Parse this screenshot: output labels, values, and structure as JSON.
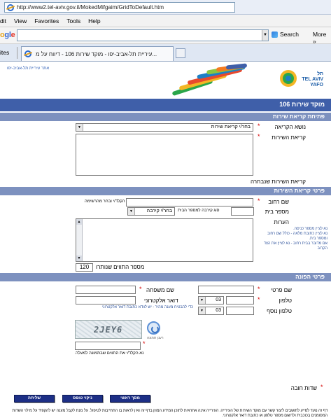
{
  "browser": {
    "address_url": "http://www2.tel-aviv.gov.il/MokedMifgaim/GridToDefault.htm",
    "menu": [
      "dit",
      "View",
      "Favorites",
      "Tools",
      "Help"
    ],
    "search_label": "Search",
    "more_label": "More »",
    "google_logo": "ogle",
    "favorites_label": "ites",
    "tab_title": "עיריית תל-אביב-יפו - מוקד שירות 106 - דיווח על מ..."
  },
  "banner": {
    "site_link": "אתר עיריית תל-אביב-יפו",
    "logo_text_line1": "תל",
    "logo_text_line2": "אביב-",
    "logo_text_line3": "TEL AVIV",
    "logo_text_line4": "YAFO",
    "logo_text_line5": "יפו",
    "stripe_colors": [
      "#2aa64a",
      "#f3b624",
      "#e8492d",
      "#1d7fc6",
      "#8bc53f",
      "#f47b20",
      "#3f5fa9"
    ]
  },
  "page_title": "מוקד שירות 106",
  "sections": {
    "open_call": "פתיחת קריאת שירות",
    "call_details": "פרטי קריאת השירות",
    "contact_details": "פרטי הפונה"
  },
  "open_call": {
    "subject_label": "נושא הקריאה",
    "subject_value": "בחר/י קריאת שירות",
    "service_call_label": "קריאת השירות",
    "selected_call_label": "קריאת השירות שנבחרה"
  },
  "call_details": {
    "street_label": "שם רחוב",
    "street_hint": "הקלד/י ובחר מהרשימה",
    "house_label": "מספר בית",
    "proximity_label": "סוג קירבה למספר הבית",
    "proximity_value": "בחר/י קירבה",
    "notes_label": "הערות",
    "notes_hint_1": "נא לציין מספר כניסה.",
    "notes_hint_2": "נא לציין כתובת מלאה - כולל שם רחוב ומספר בית.",
    "notes_hint_3": "אם מדובר בבית רחוב - נא לציין את הצד הקרוב",
    "chars_left_label": "מספר התווים שנותרו",
    "chars_left_value": "120"
  },
  "contact": {
    "first_name_label": "שם פרטי",
    "last_name_label": "שם משפחה",
    "phone_label": "טלפון",
    "phone_prefix": "03",
    "email_label": "דואר אלקטרוני",
    "email_note": "כדי להבטיח מענה מהיר - יש לוודא כתובת דואר אלקטרוני",
    "phone2_label": "טלפון נוסף",
    "phone2_prefix": "03",
    "captcha_text": "2JEY6",
    "refresh_label": "רענן תמונה",
    "captcha_hint": "נא הקלד/י את התווים שבתמונה למעלה"
  },
  "buttons": {
    "home": "מסך ראשי",
    "clear": "ניקוי טופס",
    "send": "שליחה"
  },
  "required_note": "שדות חובה",
  "footer": "דף זה נועד לסייע לתושבים ליצור קשר עם מוקד השירות של העירייה. העירייה אינה אחראית לתוכן המידע המוזן בדף זה ואין לראות בו התחייבות לטיפול. על מנת לקבל מענה יש להקפיד על מילוי השדות המסומנים בכוכבית ולרשום מספר טלפון או כתובת דואר אלקטרוני."
}
